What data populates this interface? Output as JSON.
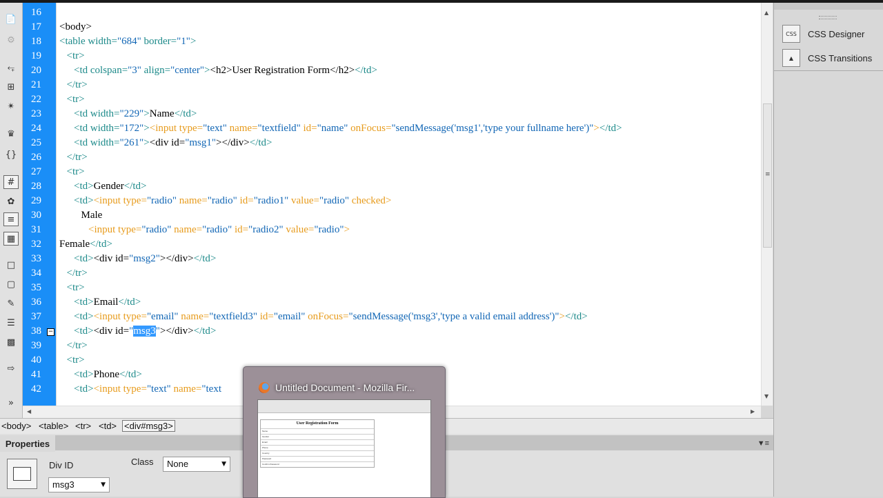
{
  "editor": {
    "lines": [
      {
        "n": "16",
        "indent": 0,
        "parts": []
      },
      {
        "n": "17",
        "indent": 0,
        "parts": [
          {
            "t": "<body>",
            "c": "x"
          }
        ]
      },
      {
        "n": "18",
        "indent": 0,
        "parts": [
          {
            "t": "<table ",
            "c": "t"
          },
          {
            "t": "width=",
            "c": "t"
          },
          {
            "t": "\"684\"",
            "c": "s"
          },
          {
            "t": " border=",
            "c": "t"
          },
          {
            "t": "\"1\"",
            "c": "s"
          },
          {
            "t": ">",
            "c": "t"
          }
        ]
      },
      {
        "n": "19",
        "indent": 1,
        "parts": [
          {
            "t": "<tr>",
            "c": "t"
          }
        ]
      },
      {
        "n": "20",
        "indent": 2,
        "parts": [
          {
            "t": "<td colspan=",
            "c": "t"
          },
          {
            "t": "\"3\"",
            "c": "s"
          },
          {
            "t": " align=",
            "c": "t"
          },
          {
            "t": "\"center\"",
            "c": "s"
          },
          {
            "t": ">",
            "c": "t"
          },
          {
            "t": "<h2>",
            "c": "x"
          },
          {
            "t": "User Registration Form",
            "c": "x"
          },
          {
            "t": "</h2>",
            "c": "x"
          },
          {
            "t": "</td>",
            "c": "t"
          }
        ]
      },
      {
        "n": "21",
        "indent": 1,
        "parts": [
          {
            "t": "</tr>",
            "c": "t"
          }
        ]
      },
      {
        "n": "22",
        "indent": 1,
        "parts": [
          {
            "t": "<tr>",
            "c": "t"
          }
        ]
      },
      {
        "n": "23",
        "indent": 2,
        "parts": [
          {
            "t": "<td width=",
            "c": "t"
          },
          {
            "t": "\"229\"",
            "c": "s"
          },
          {
            "t": ">",
            "c": "t"
          },
          {
            "t": "Name",
            "c": "x"
          },
          {
            "t": "</td>",
            "c": "t"
          }
        ]
      },
      {
        "n": "24",
        "indent": 2,
        "parts": [
          {
            "t": "<td width=",
            "c": "t"
          },
          {
            "t": "\"172\"",
            "c": "s"
          },
          {
            "t": ">",
            "c": "t"
          },
          {
            "t": "<input type=",
            "c": "f"
          },
          {
            "t": "\"text\"",
            "c": "s"
          },
          {
            "t": " name=",
            "c": "f"
          },
          {
            "t": "\"textfield\"",
            "c": "s"
          },
          {
            "t": " id=",
            "c": "f"
          },
          {
            "t": "\"name\"",
            "c": "s"
          },
          {
            "t": " onFocus=",
            "c": "f"
          },
          {
            "t": "\"sendMessage('msg1','type your fullname here')\"",
            "c": "s"
          },
          {
            "t": ">",
            "c": "f"
          },
          {
            "t": "</td>",
            "c": "t"
          }
        ]
      },
      {
        "n": "25",
        "indent": 2,
        "parts": [
          {
            "t": "<td width=",
            "c": "t"
          },
          {
            "t": "\"261\"",
            "c": "s"
          },
          {
            "t": ">",
            "c": "t"
          },
          {
            "t": "<div id=",
            "c": "x"
          },
          {
            "t": "\"msg1\"",
            "c": "s"
          },
          {
            "t": ">",
            "c": "x"
          },
          {
            "t": "</div>",
            "c": "x"
          },
          {
            "t": "</td>",
            "c": "t"
          }
        ]
      },
      {
        "n": "26",
        "indent": 1,
        "parts": [
          {
            "t": "</tr>",
            "c": "t"
          }
        ]
      },
      {
        "n": "27",
        "indent": 1,
        "parts": [
          {
            "t": "<tr>",
            "c": "t"
          }
        ]
      },
      {
        "n": "28",
        "indent": 2,
        "parts": [
          {
            "t": "<td>",
            "c": "t"
          },
          {
            "t": "Gender",
            "c": "x"
          },
          {
            "t": "</td>",
            "c": "t"
          }
        ]
      },
      {
        "n": "29",
        "indent": 2,
        "parts": [
          {
            "t": "<td>",
            "c": "t"
          },
          {
            "t": "<input type=",
            "c": "f"
          },
          {
            "t": "\"radio\"",
            "c": "s"
          },
          {
            "t": " name=",
            "c": "f"
          },
          {
            "t": "\"radio\"",
            "c": "s"
          },
          {
            "t": " id=",
            "c": "f"
          },
          {
            "t": "\"radio1\"",
            "c": "s"
          },
          {
            "t": " value=",
            "c": "f"
          },
          {
            "t": "\"radio\"",
            "c": "s"
          },
          {
            "t": " checked>",
            "c": "f"
          }
        ]
      },
      {
        "n": "30",
        "indent": 3,
        "parts": [
          {
            "t": "Male",
            "c": "x"
          }
        ]
      },
      {
        "n": "31",
        "indent": 4,
        "parts": [
          {
            "t": "<input type=",
            "c": "f"
          },
          {
            "t": "\"radio\"",
            "c": "s"
          },
          {
            "t": " name=",
            "c": "f"
          },
          {
            "t": "\"radio\"",
            "c": "s"
          },
          {
            "t": " id=",
            "c": "f"
          },
          {
            "t": "\"radio2\"",
            "c": "s"
          },
          {
            "t": " value=",
            "c": "f"
          },
          {
            "t": "\"radio\"",
            "c": "s"
          },
          {
            "t": ">",
            "c": "f"
          }
        ]
      },
      {
        "n": "32",
        "indent": 0,
        "parts": [
          {
            "t": "Female",
            "c": "x"
          },
          {
            "t": "</td>",
            "c": "t"
          }
        ]
      },
      {
        "n": "33",
        "indent": 2,
        "parts": [
          {
            "t": "<td>",
            "c": "t"
          },
          {
            "t": "<div id=",
            "c": "x"
          },
          {
            "t": "\"msg2\"",
            "c": "s"
          },
          {
            "t": ">",
            "c": "x"
          },
          {
            "t": "</div>",
            "c": "x"
          },
          {
            "t": "</td>",
            "c": "t"
          }
        ]
      },
      {
        "n": "34",
        "indent": 1,
        "parts": [
          {
            "t": "</tr>",
            "c": "t"
          }
        ]
      },
      {
        "n": "35",
        "indent": 1,
        "parts": [
          {
            "t": "<tr>",
            "c": "t"
          }
        ]
      },
      {
        "n": "36",
        "indent": 2,
        "parts": [
          {
            "t": "<td>",
            "c": "t"
          },
          {
            "t": "Email",
            "c": "x"
          },
          {
            "t": "</td>",
            "c": "t"
          }
        ]
      },
      {
        "n": "37",
        "indent": 2,
        "parts": [
          {
            "t": "<td>",
            "c": "t"
          },
          {
            "t": "<input type=",
            "c": "f"
          },
          {
            "t": "\"email\"",
            "c": "s"
          },
          {
            "t": " name=",
            "c": "f"
          },
          {
            "t": "\"textfield3\"",
            "c": "s"
          },
          {
            "t": " id=",
            "c": "f"
          },
          {
            "t": "\"email\"",
            "c": "s"
          },
          {
            "t": " onFocus=",
            "c": "f"
          },
          {
            "t": "\"sendMessage('msg3','type a valid email address')\"",
            "c": "s"
          },
          {
            "t": ">",
            "c": "f"
          },
          {
            "t": "</td>",
            "c": "t"
          }
        ]
      },
      {
        "n": "38",
        "indent": 2,
        "fold": true,
        "parts": [
          {
            "t": "<td>",
            "c": "t"
          },
          {
            "t": "<div id=",
            "c": "x"
          },
          {
            "t": "\"",
            "c": "s"
          },
          {
            "t": "msg3",
            "c": "sel"
          },
          {
            "t": "\"",
            "c": "s"
          },
          {
            "t": ">",
            "c": "x"
          },
          {
            "t": "</div>",
            "c": "x"
          },
          {
            "t": "</td>",
            "c": "t"
          }
        ]
      },
      {
        "n": "39",
        "indent": 1,
        "parts": [
          {
            "t": "</tr>",
            "c": "t"
          }
        ]
      },
      {
        "n": "40",
        "indent": 1,
        "parts": [
          {
            "t": "<tr>",
            "c": "t"
          }
        ]
      },
      {
        "n": "41",
        "indent": 2,
        "parts": [
          {
            "t": "<td>",
            "c": "t"
          },
          {
            "t": "Phone",
            "c": "x"
          },
          {
            "t": "</td>",
            "c": "t"
          }
        ]
      },
      {
        "n": "42",
        "indent": 2,
        "parts": [
          {
            "t": "<td>",
            "c": "t"
          },
          {
            "t": "<input type=",
            "c": "f"
          },
          {
            "t": "\"text\"",
            "c": "s"
          },
          {
            "t": " name=",
            "c": "f"
          },
          {
            "t": "\"text",
            "c": "s"
          }
        ]
      }
    ]
  },
  "tag_selector": [
    "<body>",
    "<table>",
    "<tr>",
    "<td>",
    "<div#msg3>"
  ],
  "right_panel": {
    "items": [
      {
        "label": "CSS Designer",
        "icon": "css-designer-icon"
      },
      {
        "label": "CSS Transitions",
        "icon": "css-transitions-icon"
      }
    ]
  },
  "properties": {
    "tab": "Properties",
    "div_id_label": "Div ID",
    "div_id_value": "msg3",
    "class_label": "Class",
    "class_value": "None"
  },
  "taskbar_preview": {
    "title": "Untitled Document - Mozilla Fir...",
    "page_heading": "User Registration Form",
    "rows": [
      "Name",
      "Gender",
      "Email",
      "Phone",
      "Country",
      "Password",
      "Confirm Password"
    ]
  },
  "colors": {
    "gutter": "#1a8ef7",
    "tag": "#1d8a8a",
    "form_tag": "#e79b1c",
    "string": "#1166b5",
    "selection": "#3399ff"
  }
}
